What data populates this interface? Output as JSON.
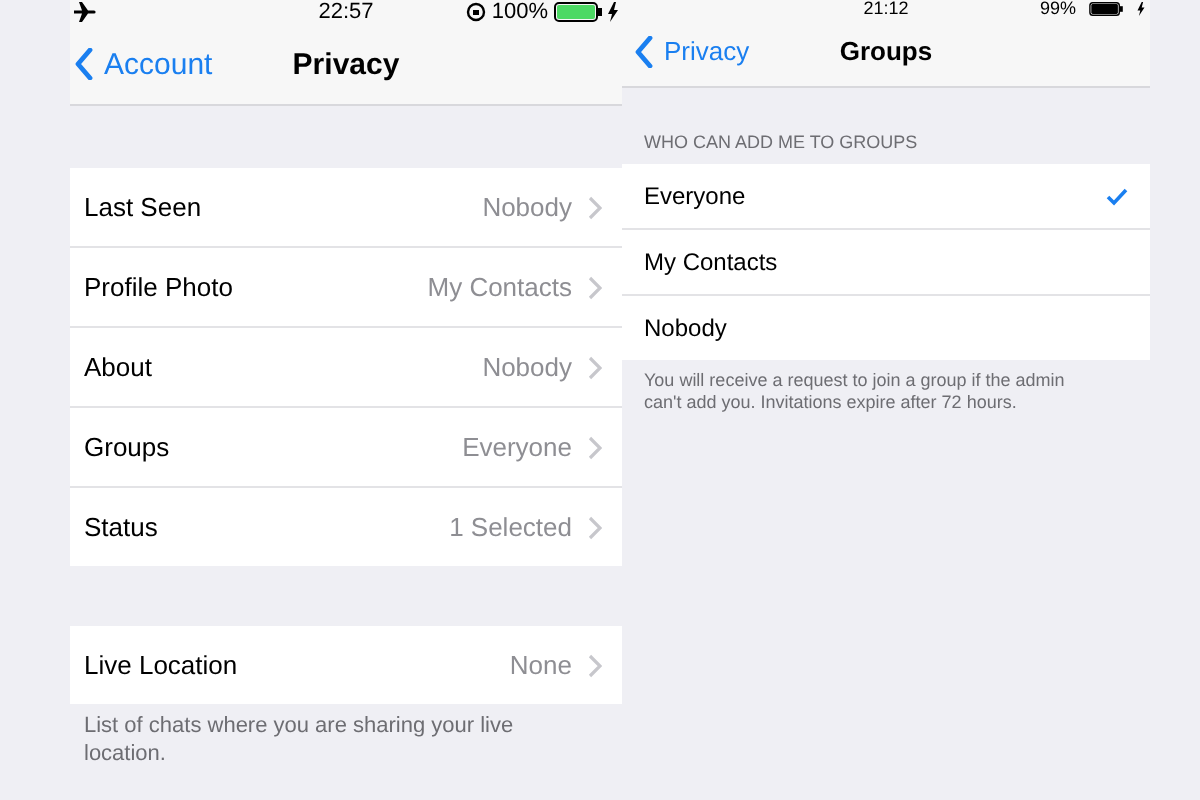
{
  "screens": [
    {
      "status_bar": {
        "time": "22:57",
        "battery": "100%",
        "charging": true,
        "airplane": true,
        "rotation_lock": true
      },
      "nav": {
        "back": "Account",
        "title": "Privacy"
      },
      "sections": [
        {
          "rows": [
            {
              "label": "Last Seen",
              "value": "Nobody"
            },
            {
              "label": "Profile Photo",
              "value": "My Contacts"
            },
            {
              "label": "About",
              "value": "Nobody"
            },
            {
              "label": "Groups",
              "value": "Everyone"
            },
            {
              "label": "Status",
              "value": "1 Selected"
            }
          ]
        },
        {
          "rows": [
            {
              "label": "Live Location",
              "value": "None"
            }
          ],
          "footer": "List of chats where you are sharing your live location."
        }
      ]
    },
    {
      "status_bar": {
        "time": "21:12",
        "battery": "99%",
        "charging": true
      },
      "nav": {
        "back": "Privacy",
        "title": "Groups"
      },
      "sections": [
        {
          "header": "WHO CAN ADD ME TO GROUPS",
          "options": [
            {
              "label": "Everyone",
              "selected": true
            },
            {
              "label": "My Contacts",
              "selected": false
            },
            {
              "label": "Nobody",
              "selected": false
            }
          ],
          "footer": "You will receive a request to join a group if the admin can't add you. Invitations expire after 72 hours."
        }
      ]
    }
  ]
}
